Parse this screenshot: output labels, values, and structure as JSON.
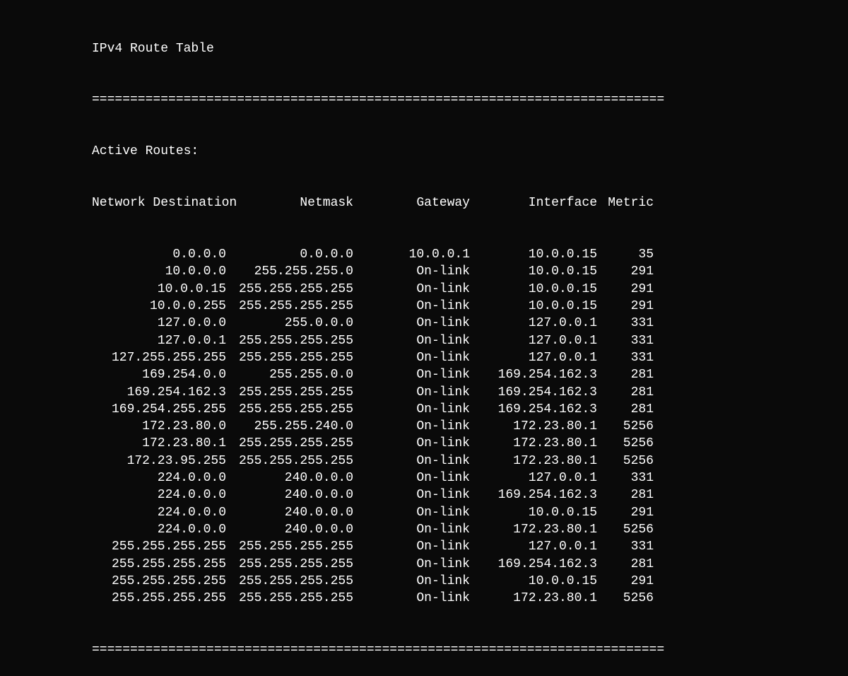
{
  "title": "IPv4 Route Table",
  "separator": "===========================================================================",
  "activeRoutesLabel": "Active Routes:",
  "headers": {
    "dest": "Network Destination",
    "mask": "Netmask",
    "gate": "Gateway",
    "iface": "Interface",
    "metric": "Metric"
  },
  "routes": [
    {
      "dest": "0.0.0.0",
      "mask": "0.0.0.0",
      "gate": "10.0.0.1",
      "iface": "10.0.0.15",
      "metric": "35"
    },
    {
      "dest": "10.0.0.0",
      "mask": "255.255.255.0",
      "gate": "On-link",
      "iface": "10.0.0.15",
      "metric": "291"
    },
    {
      "dest": "10.0.0.15",
      "mask": "255.255.255.255",
      "gate": "On-link",
      "iface": "10.0.0.15",
      "metric": "291"
    },
    {
      "dest": "10.0.0.255",
      "mask": "255.255.255.255",
      "gate": "On-link",
      "iface": "10.0.0.15",
      "metric": "291"
    },
    {
      "dest": "127.0.0.0",
      "mask": "255.0.0.0",
      "gate": "On-link",
      "iface": "127.0.0.1",
      "metric": "331"
    },
    {
      "dest": "127.0.0.1",
      "mask": "255.255.255.255",
      "gate": "On-link",
      "iface": "127.0.0.1",
      "metric": "331"
    },
    {
      "dest": "127.255.255.255",
      "mask": "255.255.255.255",
      "gate": "On-link",
      "iface": "127.0.0.1",
      "metric": "331"
    },
    {
      "dest": "169.254.0.0",
      "mask": "255.255.0.0",
      "gate": "On-link",
      "iface": "169.254.162.3",
      "metric": "281"
    },
    {
      "dest": "169.254.162.3",
      "mask": "255.255.255.255",
      "gate": "On-link",
      "iface": "169.254.162.3",
      "metric": "281"
    },
    {
      "dest": "169.254.255.255",
      "mask": "255.255.255.255",
      "gate": "On-link",
      "iface": "169.254.162.3",
      "metric": "281"
    },
    {
      "dest": "172.23.80.0",
      "mask": "255.255.240.0",
      "gate": "On-link",
      "iface": "172.23.80.1",
      "metric": "5256"
    },
    {
      "dest": "172.23.80.1",
      "mask": "255.255.255.255",
      "gate": "On-link",
      "iface": "172.23.80.1",
      "metric": "5256"
    },
    {
      "dest": "172.23.95.255",
      "mask": "255.255.255.255",
      "gate": "On-link",
      "iface": "172.23.80.1",
      "metric": "5256"
    },
    {
      "dest": "224.0.0.0",
      "mask": "240.0.0.0",
      "gate": "On-link",
      "iface": "127.0.0.1",
      "metric": "331"
    },
    {
      "dest": "224.0.0.0",
      "mask": "240.0.0.0",
      "gate": "On-link",
      "iface": "169.254.162.3",
      "metric": "281"
    },
    {
      "dest": "224.0.0.0",
      "mask": "240.0.0.0",
      "gate": "On-link",
      "iface": "10.0.0.15",
      "metric": "291"
    },
    {
      "dest": "224.0.0.0",
      "mask": "240.0.0.0",
      "gate": "On-link",
      "iface": "172.23.80.1",
      "metric": "5256"
    },
    {
      "dest": "255.255.255.255",
      "mask": "255.255.255.255",
      "gate": "On-link",
      "iface": "127.0.0.1",
      "metric": "331"
    },
    {
      "dest": "255.255.255.255",
      "mask": "255.255.255.255",
      "gate": "On-link",
      "iface": "169.254.162.3",
      "metric": "281"
    },
    {
      "dest": "255.255.255.255",
      "mask": "255.255.255.255",
      "gate": "On-link",
      "iface": "10.0.0.15",
      "metric": "291"
    },
    {
      "dest": "255.255.255.255",
      "mask": "255.255.255.255",
      "gate": "On-link",
      "iface": "172.23.80.1",
      "metric": "5256"
    }
  ]
}
